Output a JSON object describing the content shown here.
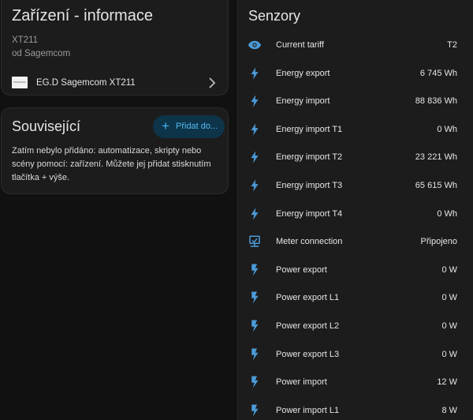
{
  "device_info": {
    "title": "Zařízení - informace",
    "model": "XT211",
    "manufacturer": "od Sagemcom",
    "integration_link": "EG.D Sagemcom XT211"
  },
  "related": {
    "title": "Související",
    "add_button_label": "Přidat do...",
    "empty_text": "Zatím nebylo přidáno: automatizace, skripty nebo scény pomocí: zařízení. Můžete jej přidat stisknutím tlačítka + výše."
  },
  "sensors": {
    "title": "Senzory",
    "items": [
      {
        "name": "Current tariff",
        "value": "T2",
        "icon": "eye-icon"
      },
      {
        "name": "Energy export",
        "value": "6 745 Wh",
        "icon": "flash-icon"
      },
      {
        "name": "Energy import",
        "value": "88 836 Wh",
        "icon": "flash-icon"
      },
      {
        "name": "Energy import T1",
        "value": "0 Wh",
        "icon": "flash-icon"
      },
      {
        "name": "Energy import T2",
        "value": "23 221 Wh",
        "icon": "flash-icon"
      },
      {
        "name": "Energy import T3",
        "value": "65 615 Wh",
        "icon": "flash-icon"
      },
      {
        "name": "Energy import T4",
        "value": "0 Wh",
        "icon": "flash-icon"
      },
      {
        "name": "Meter connection",
        "value": "Připojeno",
        "icon": "lan-connect-icon"
      },
      {
        "name": "Power export",
        "value": "0 W",
        "icon": "bolt-icon"
      },
      {
        "name": "Power export L1",
        "value": "0 W",
        "icon": "bolt-icon"
      },
      {
        "name": "Power export L2",
        "value": "0 W",
        "icon": "bolt-icon"
      },
      {
        "name": "Power export L3",
        "value": "0 W",
        "icon": "bolt-icon"
      },
      {
        "name": "Power import",
        "value": "12 W",
        "icon": "bolt-icon"
      },
      {
        "name": "Power import L1",
        "value": "8 W",
        "icon": "bolt-icon"
      }
    ]
  },
  "colors": {
    "background": "#111111",
    "card": "#1c1c1c",
    "icon": "#4b9bd8",
    "accent": "#43b4f2"
  }
}
